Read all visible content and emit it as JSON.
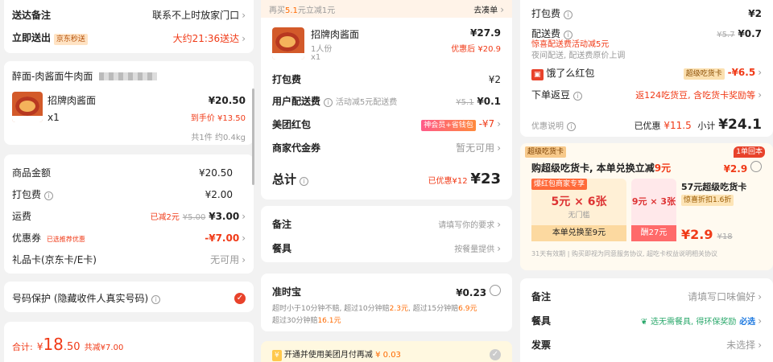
{
  "left": {
    "delivery_note_label": "送达备注",
    "delivery_note_value": "联系不上时放家门口",
    "delivery_time_label": "立即送出",
    "delivery_badge": "京东秒送",
    "delivery_time_value": "大约21:36送达",
    "shop_name": "醉面-肉酱面牛肉面",
    "item_name": "招牌肉酱面",
    "item_price": "¥20.50",
    "item_qty": "x1",
    "item_hand_price": "到手价 ¥13.50",
    "item_summary": "共1件 约0.4kg",
    "goods_amount_label": "商品金额",
    "goods_amount": "¥20.50",
    "packing_label": "打包费",
    "packing_value": "¥2.00",
    "shipping_label": "运费",
    "shipping_discount": "已减2元",
    "shipping_original": "¥5.00",
    "shipping_value": "¥3.00",
    "coupon_label": "优惠券",
    "coupon_badge": "已选推荐优惠",
    "coupon_value": "-¥7.00",
    "giftcard_label": "礼品卡(京东卡/E卡)",
    "giftcard_value": "无可用",
    "privacy_label": "号码保护 (隐藏收件人真实号码)",
    "total_prefix": "合计:",
    "total_currency": "¥",
    "total_int": "18",
    "total_dec": ".50",
    "total_saved": "共减¥7.00"
  },
  "middle": {
    "top_hint": "再买",
    "top_hint_amount": "5.1",
    "top_hint_suffix": "元立减1元",
    "top_hint_link": "去凑单",
    "item_name": "招牌肉酱面",
    "item_spec": "1人份",
    "item_qty": "x1",
    "item_price": "¥27.9",
    "item_after": "优惠后 ¥20.9",
    "packing_label": "打包费",
    "packing_value": "¥2",
    "user_delivery_label": "用户配送费",
    "user_delivery_note": "活动减5元配送费",
    "user_delivery_original": "¥5.1",
    "user_delivery_value": "¥0.1",
    "redpacket_label": "美团红包",
    "redpacket_badge": "神会员+省钱包",
    "redpacket_value": "-¥7",
    "voucher_label": "商家代金券",
    "voucher_value": "暂无可用",
    "total_label": "总计",
    "total_saved": "已优惠¥12",
    "total_value": "¥23",
    "remark_label": "备注",
    "remark_value": "请填写你的要求",
    "tableware_label": "餐具",
    "tableware_value": "按餐量提供",
    "ontime_label": "准时宝",
    "ontime_price": "¥0.23",
    "ontime_desc1_a": "超时小于10分钟不赔, 超过10分钟赔",
    "ontime_desc1_b": "2.3元",
    "ontime_desc1_c": ", 超过15分钟赔",
    "ontime_desc1_d": "6.9元",
    "ontime_desc2_a": "超过30分钟赔",
    "ontime_desc2_b": "16.1元",
    "monthpay_label": "开通并使用美团月付再减",
    "monthpay_value": "¥ 0.03"
  },
  "right": {
    "packing_label": "打包费",
    "packing_value": "¥2",
    "delivery_label": "配送费",
    "delivery_original": "¥5.7",
    "delivery_value": "¥0.7",
    "delivery_note1": "惊喜配送费活动减5元",
    "delivery_note2": "夜间配送, 配送费原价上调",
    "redpacket_label": "饿了么红包",
    "redpacket_badge": "超级吃货卡",
    "redpacket_value": "-¥6.5",
    "cashback_label": "下单返豆",
    "cashback_value": "返124吃货豆, 含吃货卡奖励等",
    "discount_label": "优惠说明",
    "discount_saved_label": "已优惠",
    "discount_saved": "¥11.5",
    "subtotal_label": "小计",
    "subtotal_value": "¥24.1",
    "card_badge": "超级吃货卡",
    "card_corner": "1单回本",
    "card_title_a": "购超级吃货卡, 本单兑换立减",
    "card_title_b": "9元",
    "card_price": "¥2.9",
    "shop_tag": "爆红包商家专享",
    "coupon1_amount": "5元 × 6张",
    "coupon1_sub": "无门槛",
    "coupon1_foot": "本单兑换至9元",
    "coupon2_amount": "9元 × 3张",
    "coupon2_foot": "酬27元",
    "card_name": "57元超级吃货卡",
    "card_tag": "惊喜折扣1.6折",
    "card_final": "¥2.9",
    "card_final_orig": "¥18",
    "card_terms": "31天有效期 | 购买即视为同意服务协议, 超吃卡权益说明相关协议",
    "remark_label": "备注",
    "remark_value": "请填写口味偏好",
    "tableware_label": "餐具",
    "tableware_value": "选无需餐具, 得环保奖励",
    "tableware_link": "必选",
    "invoice_label": "发票",
    "invoice_value": "未选择"
  },
  "colors": {
    "red": "#f03a17",
    "orange": "#ff6a00",
    "jd_badge": "#ffd9b3",
    "meituan_badge": "#ff4d7a",
    "eleme_gold": "#fbe0b0"
  }
}
